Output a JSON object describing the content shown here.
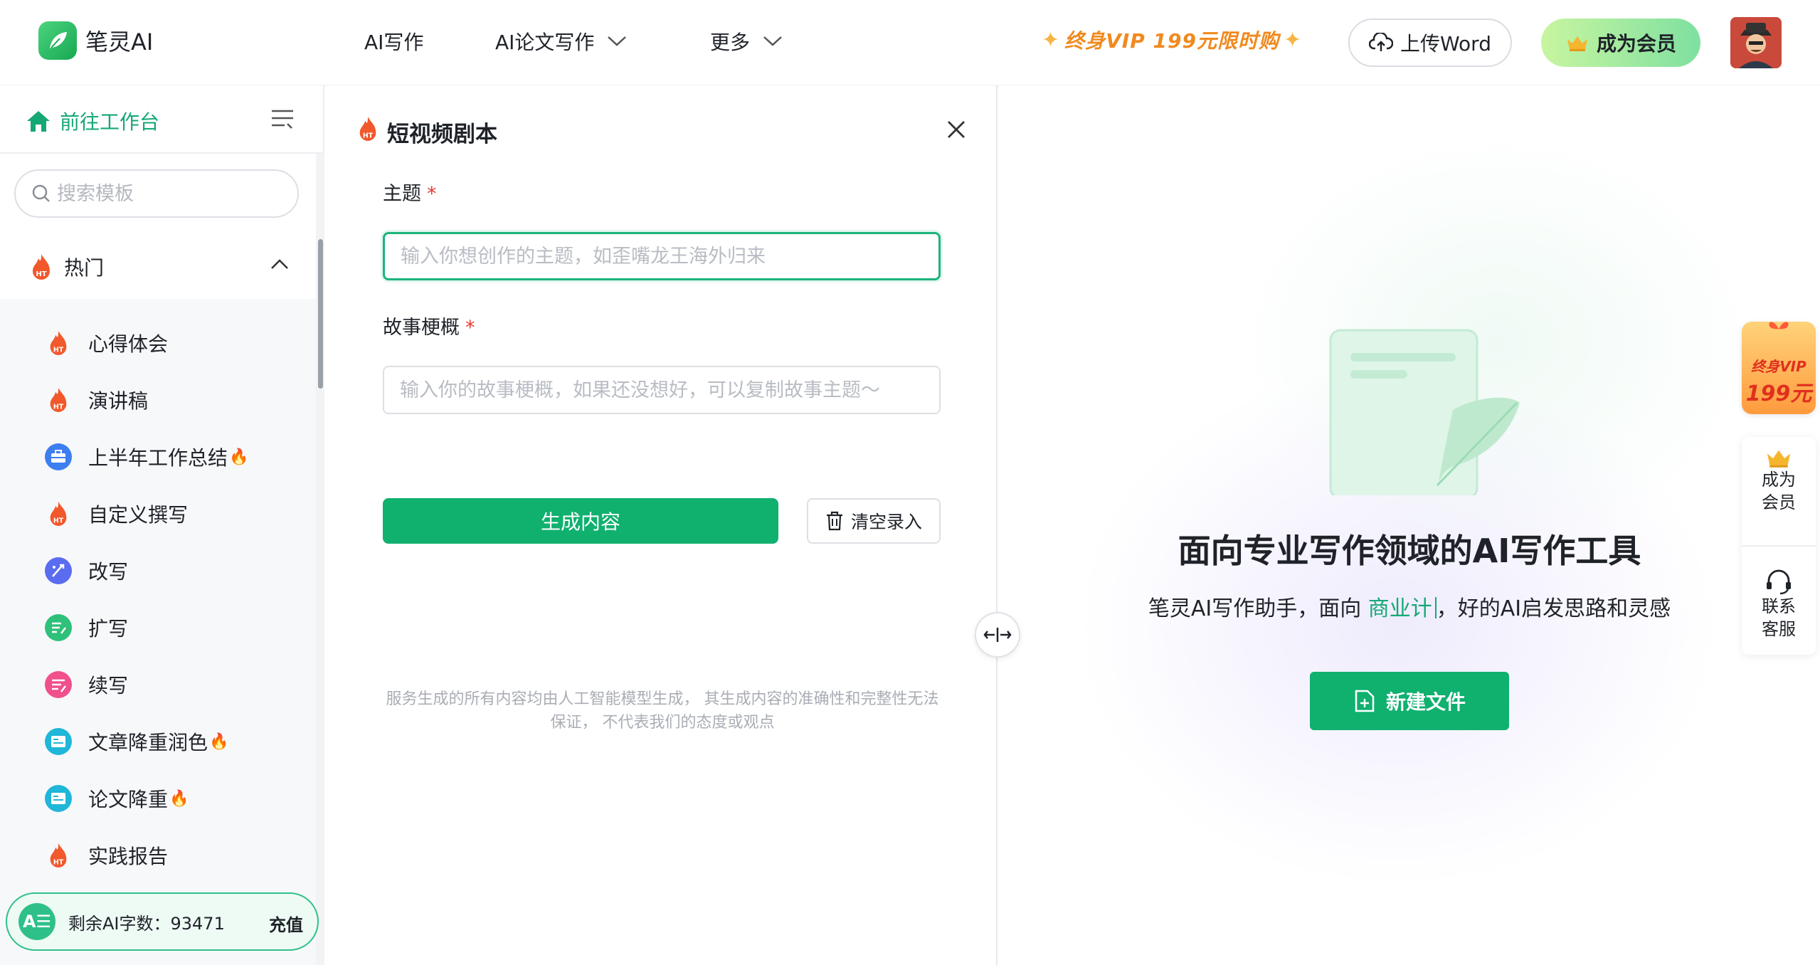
{
  "header": {
    "logo_text": "笔灵AI",
    "nav": [
      {
        "label": "AI写作",
        "has_dropdown": false
      },
      {
        "label": "AI论文写作",
        "has_dropdown": true
      },
      {
        "label": "更多",
        "has_dropdown": true
      }
    ],
    "promo_text": "终身VIP 199元限时购",
    "upload_label": "上传Word",
    "member_label": "成为会员"
  },
  "sidebar": {
    "goto_workspace": "前往工作台",
    "search_placeholder": "搜索模板",
    "group_label": "热门",
    "items": [
      {
        "label": "心得体会",
        "icon": "fire-icon",
        "hot": false
      },
      {
        "label": "演讲稿",
        "icon": "fire-icon",
        "hot": false
      },
      {
        "label": "上半年工作总结",
        "icon": "briefcase-icon",
        "hot": true
      },
      {
        "label": "自定义撰写",
        "icon": "fire-icon",
        "hot": false
      },
      {
        "label": "改写",
        "icon": "rewrite-icon",
        "hot": false
      },
      {
        "label": "扩写",
        "icon": "expand-icon",
        "hot": false
      },
      {
        "label": "续写",
        "icon": "continue-icon",
        "hot": false
      },
      {
        "label": "文章降重润色",
        "icon": "article-icon",
        "hot": true
      },
      {
        "label": "论文降重",
        "icon": "paper-icon",
        "hot": true
      },
      {
        "label": "实践报告",
        "icon": "fire-icon",
        "hot": false
      }
    ],
    "hot_mark": "🔥",
    "quota_icon_text": "A☰",
    "quota_text": "剩余AI字数：93471",
    "charge_label": "充值"
  },
  "form": {
    "title": "短视频剧本",
    "fields": [
      {
        "label": "主题",
        "required_mark": "*",
        "placeholder": "输入你想创作的主题，如歪嘴龙王海外归来",
        "value": ""
      },
      {
        "label": "故事梗概",
        "required_mark": "*",
        "placeholder": "输入你的故事梗概，如果还没想好，可以复制故事主题～",
        "value": ""
      }
    ],
    "generate_label": "生成内容",
    "clear_label": "清空录入",
    "disclaimer_line1": "服务生成的所有内容均由人工智能模型生成，  其生成内容的准确性和完整性无法",
    "disclaimer_line2": "保证，  不代表我们的态度或观点"
  },
  "hero": {
    "title": "面向专业写作领域的AI写作工具",
    "subtitle_prefix": "笔灵AI写作助手，面向 ",
    "subtitle_highlight": "商业计",
    "subtitle_suffix": "，好的AI启发思路和灵感",
    "new_file_label": "新建文件"
  },
  "side_widgets": {
    "vip_line1": "终身VIP",
    "vip_line2": "199元",
    "become_member_line1": "成为",
    "become_member_line2": "会员",
    "contact_line1": "联系",
    "contact_line2": "客服"
  },
  "colors": {
    "brand_green": "#10b06f",
    "link_green": "#15a874",
    "promo_orange": "#f08a1e",
    "required_red": "#e53935"
  }
}
